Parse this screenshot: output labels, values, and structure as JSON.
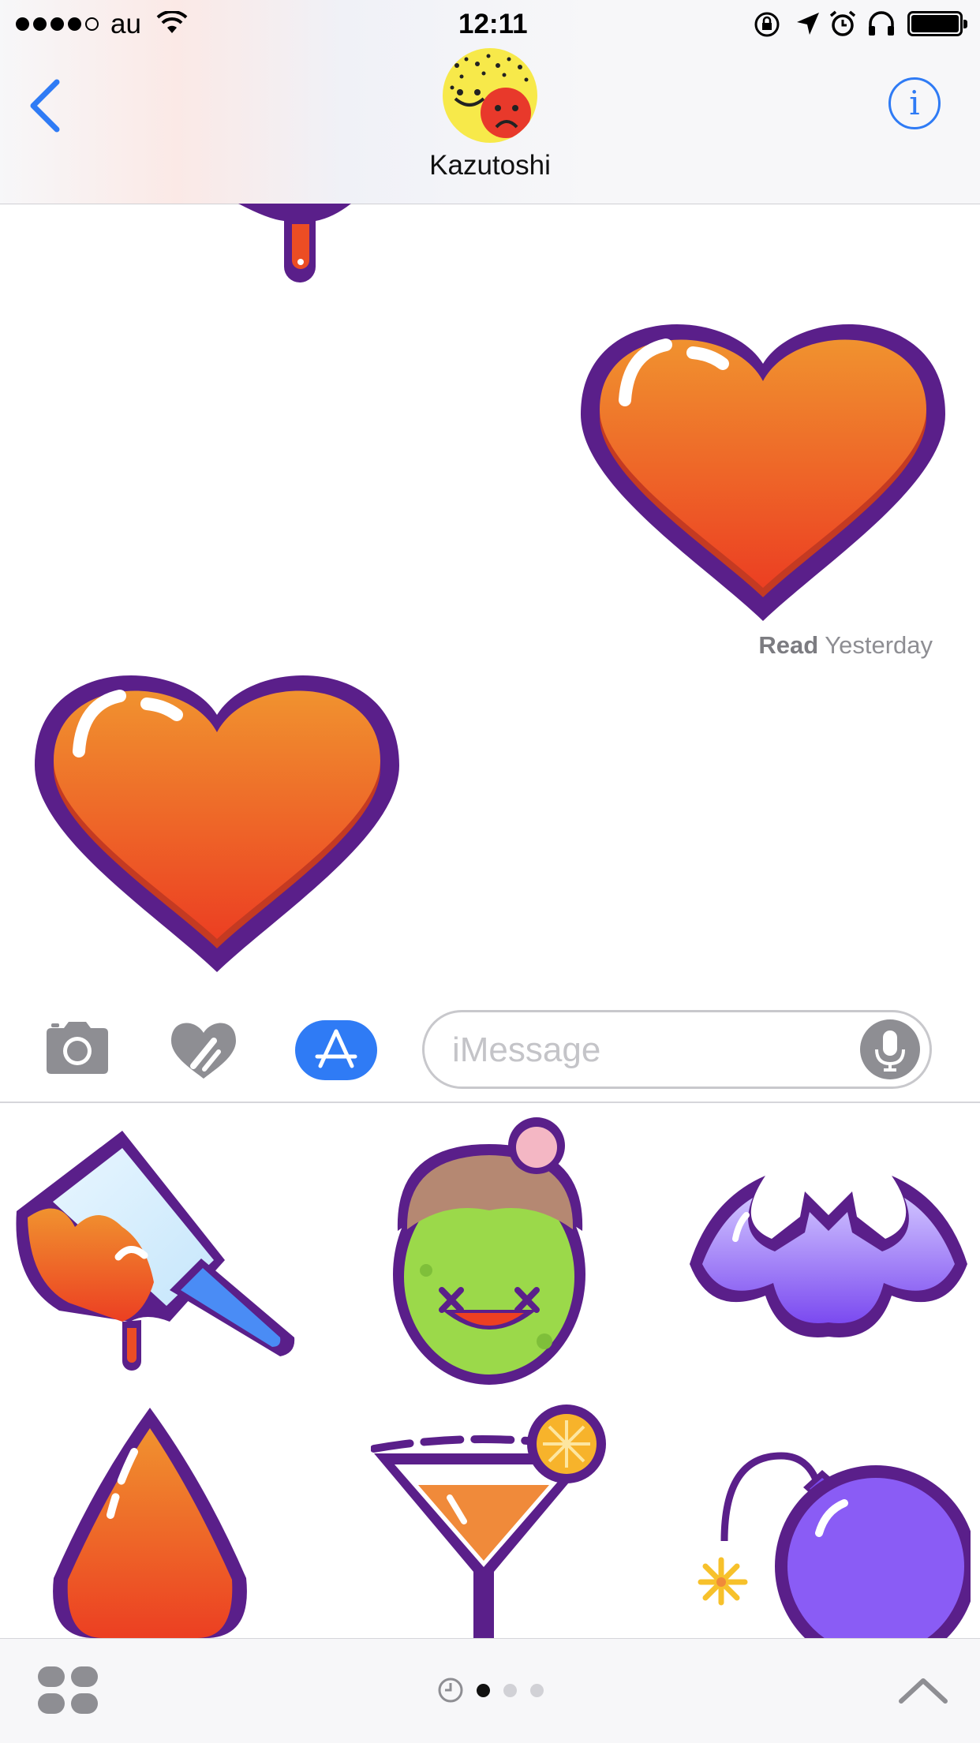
{
  "status_bar": {
    "carrier": "au",
    "time": "12:11",
    "signal_bars": 4,
    "battery_level": 1.0
  },
  "header": {
    "contact_name": "Kazutoshi",
    "back_icon": "chevron-left-icon",
    "info_icon": "info-icon",
    "info_glyph": "i"
  },
  "messages": {
    "read_label": "Read",
    "read_time": "Yesterday"
  },
  "input_bar": {
    "placeholder": "iMessage",
    "accent_color": "#2f7bf5"
  },
  "sticker_drawer": {
    "stickers": [
      "cleaver-sticker",
      "zombie-sticker",
      "bat-sticker",
      "blood-drop-sticker",
      "cocktail-sticker",
      "bomb-sticker"
    ],
    "page_count": 3,
    "current_page": 0
  },
  "colors": {
    "heart_outline": "#5a1f8a",
    "heart_top": "#f0922f",
    "heart_bottom": "#ec3f22",
    "accent": "#2f7bf5"
  }
}
